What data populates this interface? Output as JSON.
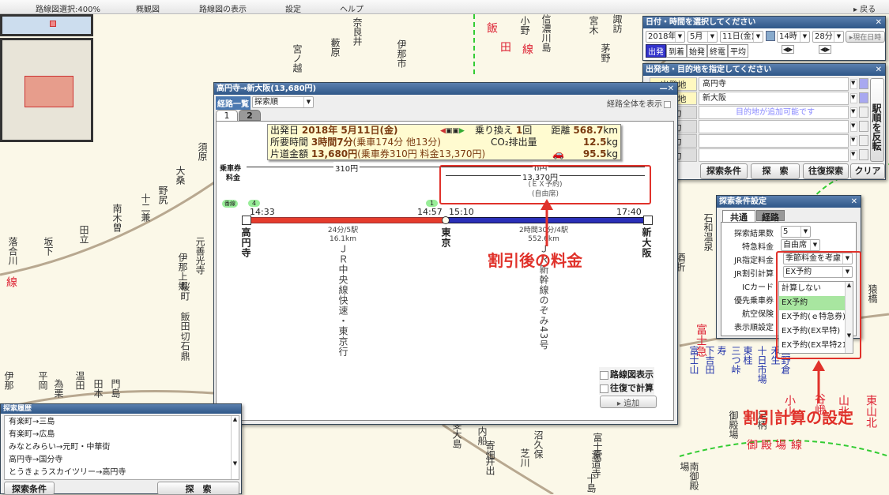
{
  "menu": {
    "items": [
      "路線図選択:400%",
      "概観図",
      "路線図の表示",
      "設定",
      "ヘルプ"
    ],
    "back": "▸ 戻る"
  },
  "map": {
    "labels": [
      "諏訪",
      "飯",
      "田",
      "線",
      "奈良井",
      "藪原",
      "伊那市",
      "宮ノ越",
      "小野",
      "信濃川島",
      "宮木",
      "茅野",
      "須原",
      "大桑",
      "野尻",
      "十二兼",
      "南木曽",
      "田立",
      "坂下",
      "落合川",
      "線",
      "元善光寺",
      "伊那上郷",
      "桜町",
      "飯田",
      "切石",
      "鼎",
      "石和温泉",
      "酒折",
      "猿橋",
      "富士急",
      "甲斐大島",
      "内船",
      "寄畑",
      "井出",
      "芝川",
      "沼久保",
      "富士宮",
      "源道寺",
      "十島",
      "御殿場",
      "足柄",
      "小山",
      "谷峨",
      "山北",
      "東山北",
      "御",
      "殿",
      "場",
      "線",
      "南御殿場",
      "富士山",
      "下吉田",
      "寿",
      "三つ峠",
      "東桂",
      "十日市場",
      "禾生",
      "田野倉",
      "伊那",
      "平岡",
      "温田",
      "為栗",
      "田本",
      "門島"
    ]
  },
  "colors": {
    "line_chuo": "#e53b2c",
    "line_shinkansen": "#2a2fb8",
    "annotation": "#e0322b",
    "titlebar": "#3a6193"
  },
  "route_window": {
    "title": "高円寺→新大阪(13,680円)",
    "list_label": "経路一覧",
    "sort_value": "探索順",
    "show_all": "経路全体を表示",
    "tabs": [
      "1",
      "2"
    ],
    "summary": {
      "date_label": "出発日",
      "date_value": "2018年 5月11日(金)",
      "transfer_label": "乗り換え",
      "transfer_value": "1",
      "transfer_unit": "回",
      "distance_label": "距離",
      "distance_value": "568.7",
      "distance_unit": "km",
      "time_label": "所要時間",
      "time_value": "3時間7分",
      "time_detail": "(乗車174分 他13分)",
      "co2_label": "CO₂排出量",
      "co2_value": "12.5",
      "co2_unit": "kg",
      "fare_label": "片道金額",
      "fare_value": "13,680円",
      "fare_detail": "(乗車券310円 料金13,370円)",
      "car_value": "95.5",
      "car_unit": "kg"
    },
    "ticket_label": "乗車券",
    "fee_label": "料金",
    "ticket_seg1": "310円",
    "ticket_seg2": "0円",
    "fee_value": "13,370円",
    "fee_type": "(ＥＸ予約)",
    "fee_seat": "(自由席)",
    "platform_tag": "番線",
    "platforms": [
      "4",
      "1"
    ],
    "times": [
      "14:33",
      "14:57",
      "15:10",
      "17:40"
    ],
    "stations": [
      "高円寺",
      "東京",
      "新大阪"
    ],
    "seg1": {
      "time": "24分/5駅",
      "dist": "16.1km",
      "name": "ＪＲ中央線快速・東京行"
    },
    "seg2": {
      "time": "2時間30分/4駅",
      "dist": "552.6km",
      "name": "ＪＲ新幹線のぞみ43号"
    },
    "check_map": "路線図表示",
    "check_round": "往復で計算",
    "add": "追加"
  },
  "date_panel": {
    "title": "日付・時間を選択してください",
    "year": "2018年",
    "month": "5月",
    "day": "11日(金)",
    "hour": "14時",
    "minute": "28分",
    "now": "▸現在日時",
    "modes": [
      "出発",
      "到着",
      "始発",
      "終電",
      "平均"
    ]
  },
  "place_panel": {
    "title": "出発地・目的地を指定してください",
    "from_label": "出発地",
    "from": "高円寺",
    "to_label": "目的地",
    "to": "新大阪",
    "placeholder": "目的地が追加可能です",
    "input_label": "入力",
    "reverse": "駅順を反転",
    "buttons": [
      "なし",
      "探索条件",
      "探　索",
      "往復探索",
      "クリア"
    ]
  },
  "conditions": {
    "title": "探索条件設定",
    "tabs": [
      "共通",
      "経路"
    ],
    "rows": [
      {
        "label": "探索結果数",
        "value": "5"
      },
      {
        "label": "特急料金",
        "value": "自由席"
      },
      {
        "label": "JR指定料金",
        "value": "季節料金を考慮"
      },
      {
        "label": "JR割引計算",
        "value": "EX予約"
      },
      {
        "label": "ICカード",
        "value": ""
      },
      {
        "label": "優先乗車券",
        "value": ""
      },
      {
        "label": "航空保険",
        "value": ""
      },
      {
        "label": "表示順設定",
        "value": ""
      }
    ],
    "options": [
      "計算しない",
      "EX予約",
      "EX予約(ｅ特急券)",
      "EX予約(EX早特)",
      "EX予約(EX早特21"
    ],
    "selected": "EX予約"
  },
  "history": {
    "title": "探索履歴",
    "items": [
      "有楽町→三島",
      "有楽町→広島",
      "みなとみらい→元町・中華街",
      "高円寺→国分寺",
      "とうきょうスカイツリー→高円寺"
    ],
    "cond_button": "探索条件",
    "search_button": "探　索"
  },
  "annotations": {
    "fee": "割引後の料金",
    "discount": "割引計算の設定"
  }
}
